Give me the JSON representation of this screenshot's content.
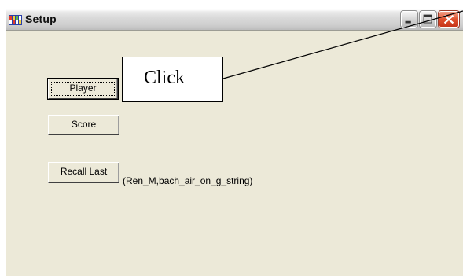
{
  "window": {
    "title": "Setup",
    "app_icon": "setup-app-icon"
  },
  "caption_buttons": {
    "minimize_icon": "minimize-icon",
    "maximize_icon": "maximize-icon",
    "close_icon": "close-icon"
  },
  "buttons": {
    "player_label": "Player",
    "score_label": "Score",
    "recall_last_label": "Recall Last"
  },
  "recall_info": "(Ren_M,bach_air_on_g_string)",
  "callout": {
    "text": "Click"
  },
  "colors": {
    "dialog_face": "#ece9d8",
    "close_button": "#e0502d"
  }
}
